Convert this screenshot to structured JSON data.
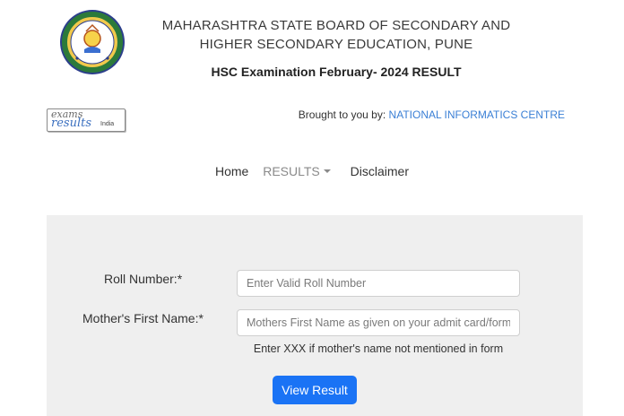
{
  "header": {
    "board_line1": "MAHARASHTRA STATE BOARD OF SECONDARY AND",
    "board_line2": "HIGHER SECONDARY EDUCATION, PUNE",
    "exam_title": "HSC Examination February- 2024 RESULT",
    "logo_icon": "board-seal-icon"
  },
  "partner": {
    "logo_exams": "exams",
    "logo_results": "results",
    "logo_india": "India",
    "brought_prefix": "Brought to you by:",
    "brought_link": "NATIONAL INFORMATICS CENTRE"
  },
  "nav": {
    "home": "Home",
    "results": "RESULTS",
    "disclaimer": "Disclaimer"
  },
  "form": {
    "roll_label": "Roll Number:*",
    "roll_value": "",
    "roll_placeholder": "Enter Valid Roll Number",
    "mother_label": "Mother's First Name:*",
    "mother_value": "",
    "mother_placeholder": "Mothers First Name as given on your admit card/form",
    "hint": "Enter XXX if mother's name not mentioned in form",
    "submit_label": "View Result"
  },
  "colors": {
    "accent": "#1a73f5",
    "link": "#3a7fd5",
    "panel_bg": "#efefef"
  }
}
